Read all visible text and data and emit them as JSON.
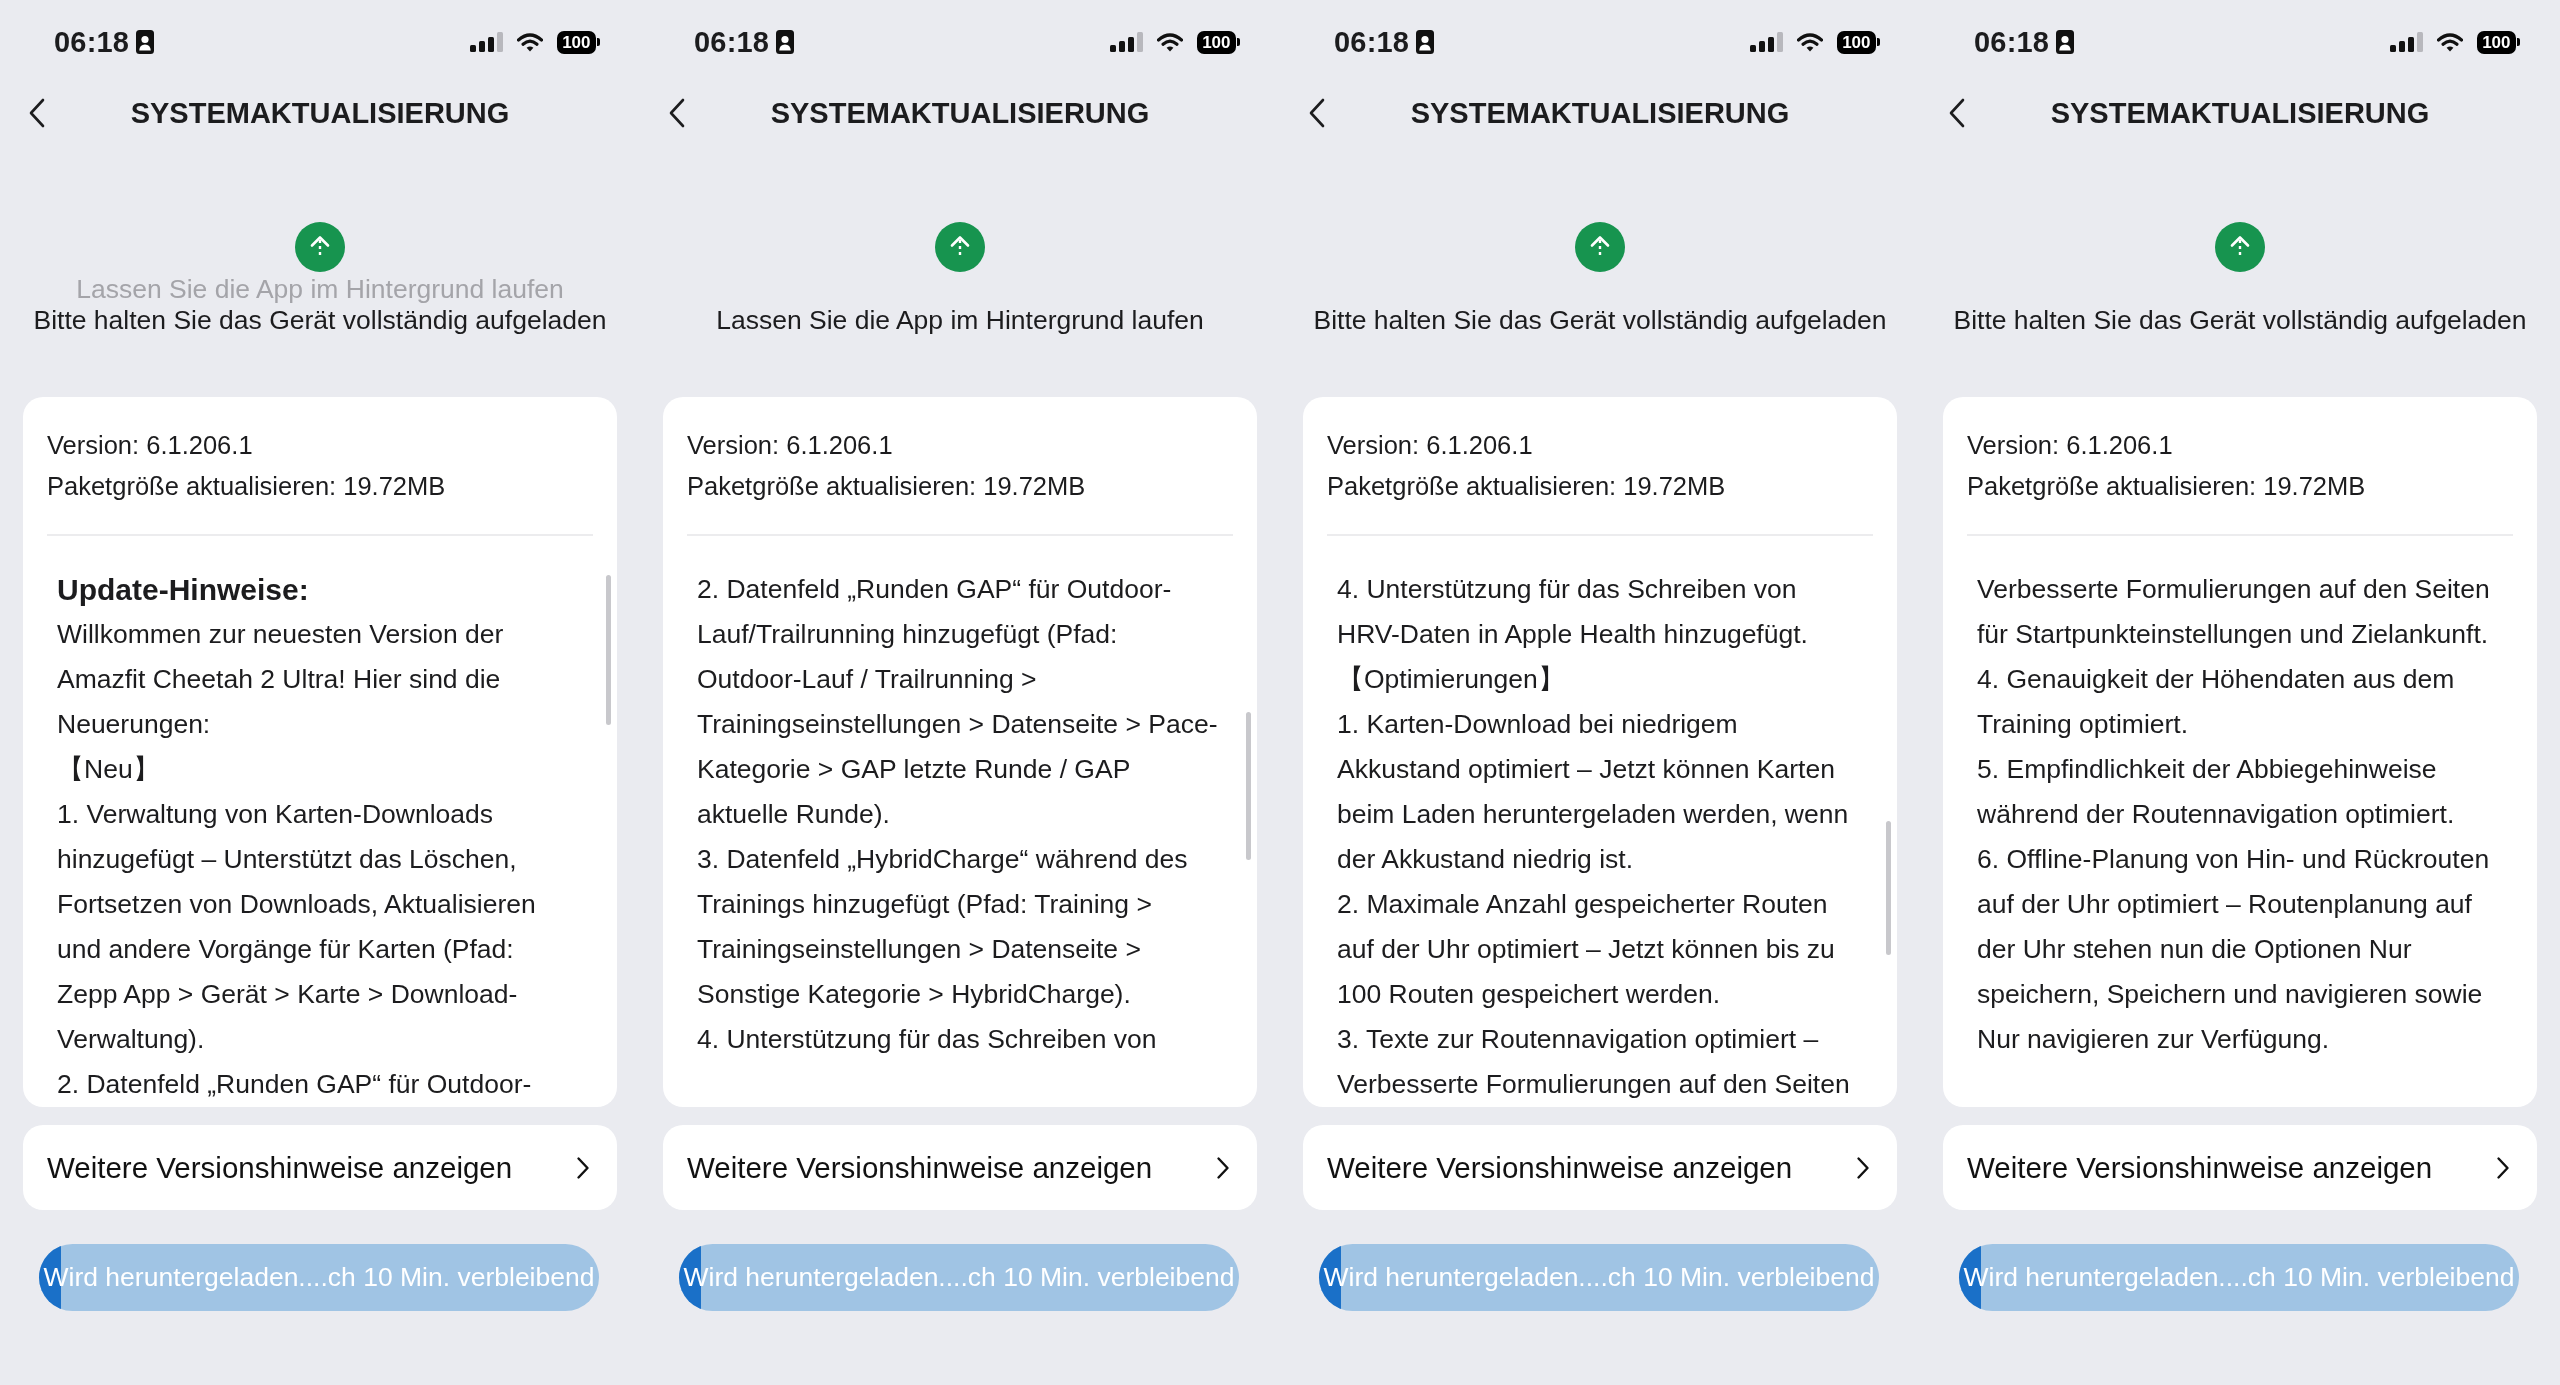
{
  "panels": [
    {
      "status_bar": {
        "time": "06:18",
        "battery": "100"
      },
      "nav": {
        "title": "SYSTEMAKTUALISIERUNG"
      },
      "tips": [
        {
          "text": "Lassen Sie die App im Hintergrund laufen",
          "faded": true
        },
        {
          "text": "Bitte halten Sie das Gerät vollständig aufgeladen",
          "faded": false
        }
      ],
      "info": {
        "version": "Version: 6.1.206.1",
        "package_size": "Paketgröße aktualisieren: 19.72MB"
      },
      "notes": {
        "heading": "Update-Hinweise:",
        "paragraphs": [
          "Willkommen zur neuesten Version der Amazfit Cheetah 2 Ultra! Hier sind die Neuerungen:",
          "【Neu】",
          "1. Verwaltung von Karten-Downloads hinzugefügt – Unterstützt das Löschen, Fortsetzen von Downloads, Aktualisieren und andere Vorgänge für Karten (Pfad: Zepp App > Gerät > Karte > Download-Verwaltung).",
          "2. Datenfeld „Runden GAP“ für Outdoor-"
        ]
      },
      "more_button": {
        "label": "Weitere Versionshinweise anzeigen"
      },
      "download": {
        "label": "Wird heruntergeladen....ch 10 Min. verbleibend",
        "level": 0.04
      }
    },
    {
      "status_bar": {
        "time": "06:18",
        "battery": "100"
      },
      "nav": {
        "title": "SYSTEMAKTUALISIERUNG"
      },
      "tips": [
        {
          "text": "Lassen Sie die App im Hintergrund laufen",
          "faded": false
        }
      ],
      "info": {
        "version": "Version: 6.1.206.1",
        "package_size": "Paketgröße aktualisieren: 19.72MB"
      },
      "notes": {
        "paragraphs": [
          "2. Datenfeld „Runden GAP“ für Outdoor-Lauf/Trailrunning hinzugefügt (Pfad: Outdoor-Lauf / Trailrunning > Trainingseinstellungen > Datenseite > Pace-Kategorie > GAP letzte Runde / GAP aktuelle Runde).",
          "3. Datenfeld „HybridCharge“ während des Trainings hinzugefügt (Pfad: Training > Trainingseinstellungen > Datenseite > Sonstige Kategorie > HybridCharge).",
          "4. Unterstützung für das Schreiben von"
        ]
      },
      "more_button": {
        "label": "Weitere Versionshinweise anzeigen"
      },
      "download": {
        "label": "Wird heruntergeladen....ch 10 Min. verbleibend",
        "level": 0.04
      }
    },
    {
      "status_bar": {
        "time": "06:18",
        "battery": "100"
      },
      "nav": {
        "title": "SYSTEMAKTUALISIERUNG"
      },
      "tips": [
        {
          "text": "Bitte halten Sie das Gerät vollständig aufgeladen",
          "faded": false
        }
      ],
      "info": {
        "version": "Version: 6.1.206.1",
        "package_size": "Paketgröße aktualisieren: 19.72MB"
      },
      "notes": {
        "paragraphs": [
          "4. Unterstützung für das Schreiben von HRV-Daten in Apple Health hinzugefügt.",
          "【Optimierungen】",
          "1. Karten-Download bei niedrigem Akkustand optimiert – Jetzt können Karten beim Laden heruntergeladen werden, wenn der Akkustand niedrig ist.",
          "2. Maximale Anzahl gespeicherter Routen auf der Uhr optimiert – Jetzt können bis zu 100 Routen gespeichert werden.",
          "3. Texte zur Routennavigation optimiert – Verbesserte Formulierungen auf den Seiten"
        ]
      },
      "more_button": {
        "label": "Weitere Versionshinweise anzeigen"
      },
      "download": {
        "label": "Wird heruntergeladen....ch 10 Min. verbleibend",
        "level": 0.04
      }
    },
    {
      "status_bar": {
        "time": "06:18",
        "battery": "100"
      },
      "nav": {
        "title": "SYSTEMAKTUALISIERUNG"
      },
      "tips": [
        {
          "text": "Bitte halten Sie das Gerät vollständig aufgeladen",
          "faded": false
        }
      ],
      "info": {
        "version": "Version: 6.1.206.1",
        "package_size": "Paketgröße aktualisieren: 19.72MB"
      },
      "notes": {
        "paragraphs": [
          "Verbesserte Formulierungen auf den Seiten für Startpunkteinstellungen und Zielankunft.",
          "4. Genauigkeit der Höhendaten aus dem Training optimiert.",
          "5. Empfindlichkeit der Abbiegehinweise während der Routennavigation optimiert.",
          "6. Offline-Planung von Hin- und Rückrouten auf der Uhr optimiert – Routenplanung auf der Uhr stehen nun die Optionen Nur speichern, Speichern und navigieren sowie Nur navigieren zur Verfügung."
        ]
      },
      "more_button": {
        "label": "Weitere Versionshinweise anzeigen"
      },
      "download": {
        "label": "Wird heruntergeladen....ch 10 Min. verbleibend",
        "level": 0.04
      }
    }
  ]
}
